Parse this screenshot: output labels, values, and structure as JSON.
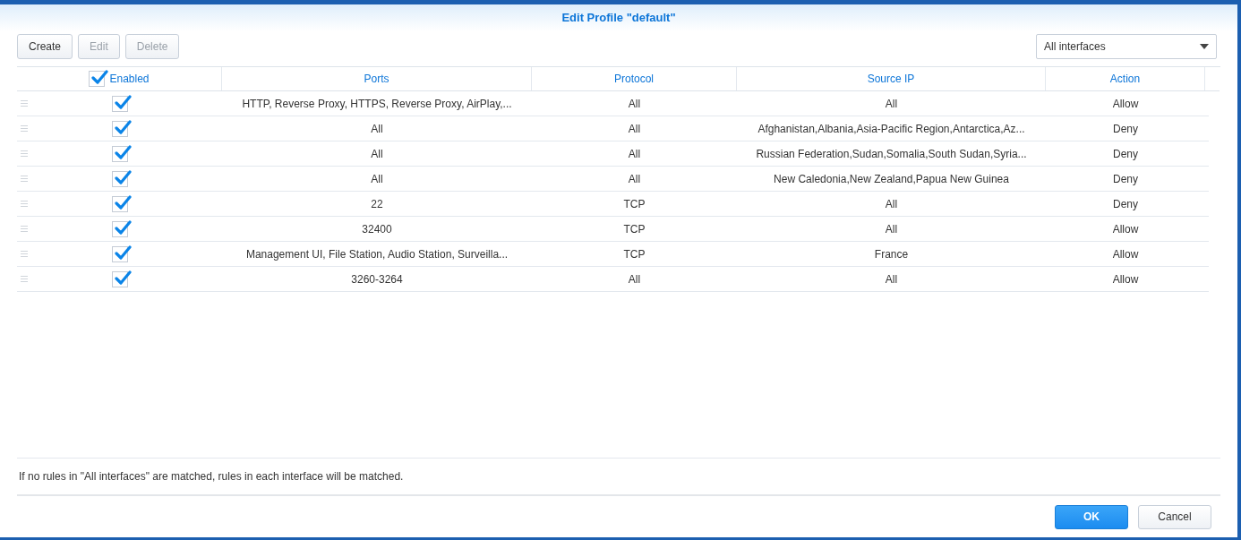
{
  "window": {
    "title": "Edit Profile \"default\""
  },
  "toolbar": {
    "buttons": [
      {
        "label": "Create",
        "disabled": false
      },
      {
        "label": "Edit",
        "disabled": true
      },
      {
        "label": "Delete",
        "disabled": true
      }
    ],
    "interface_select": {
      "value": "All interfaces"
    }
  },
  "table": {
    "columns": [
      {
        "label": "Enabled",
        "checked": true
      },
      {
        "label": "Ports"
      },
      {
        "label": "Protocol"
      },
      {
        "label": "Source IP"
      },
      {
        "label": "Action"
      }
    ],
    "rows": [
      {
        "enabled": true,
        "ports": "HTTP, Reverse Proxy, HTTPS, Reverse Proxy, AirPlay,...",
        "protocol": "All",
        "source_ip": "All",
        "action": "Allow"
      },
      {
        "enabled": true,
        "ports": "All",
        "protocol": "All",
        "source_ip": "Afghanistan,Albania,Asia-Pacific Region,Antarctica,Az...",
        "action": "Deny"
      },
      {
        "enabled": true,
        "ports": "All",
        "protocol": "All",
        "source_ip": "Russian Federation,Sudan,Somalia,South Sudan,Syria...",
        "action": "Deny"
      },
      {
        "enabled": true,
        "ports": "All",
        "protocol": "All",
        "source_ip": "New Caledonia,New Zealand,Papua New Guinea",
        "action": "Deny"
      },
      {
        "enabled": true,
        "ports": "22",
        "protocol": "TCP",
        "source_ip": "All",
        "action": "Deny"
      },
      {
        "enabled": true,
        "ports": "32400",
        "protocol": "TCP",
        "source_ip": "All",
        "action": "Allow"
      },
      {
        "enabled": true,
        "ports": "Management UI, File Station, Audio Station, Surveilla...",
        "protocol": "TCP",
        "source_ip": "France",
        "action": "Allow"
      },
      {
        "enabled": true,
        "ports": "3260-3264",
        "protocol": "All",
        "source_ip": "All",
        "action": "Allow"
      }
    ]
  },
  "note": "If no rules in \"All interfaces\" are matched, rules in each interface will be matched.",
  "footer": {
    "buttons": [
      {
        "label": "OK",
        "kind": "primary"
      },
      {
        "label": "Cancel",
        "kind": "secondary"
      }
    ]
  }
}
